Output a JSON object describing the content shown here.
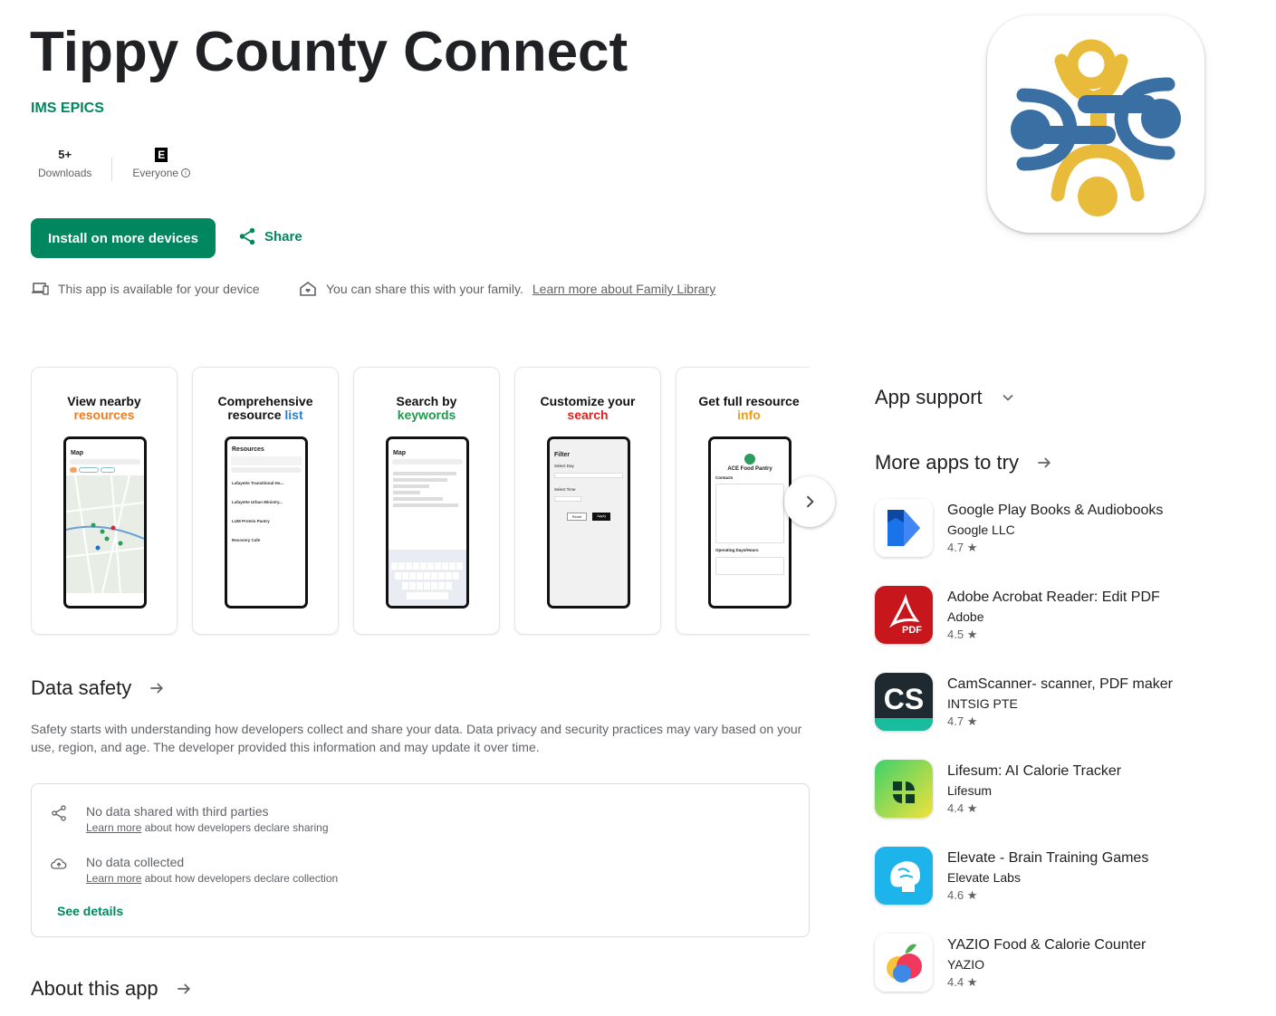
{
  "app": {
    "title": "Tippy County Connect",
    "developer": "IMS EPICS"
  },
  "stats": {
    "downloads_value": "5+",
    "downloads_label": "Downloads",
    "rating_icon": "E",
    "rating_label": "Everyone"
  },
  "actions": {
    "install_label": "Install on more devices",
    "share_label": "Share"
  },
  "availability": {
    "device_text": "This app is available for your device",
    "family_text": "You can share this with your family.",
    "family_link": "Learn more about Family Library"
  },
  "screenshots": [
    {
      "line1": "View nearby",
      "line2": "resources",
      "color": "#f07c1f"
    },
    {
      "line1": "Comprehensive",
      "line2a": "resource ",
      "line2b": "list",
      "color": "#2b7fd6"
    },
    {
      "line1": "Search by",
      "line2": "keywords",
      "color": "#1d9a4d"
    },
    {
      "line1": "Customize your",
      "line2": "search",
      "color": "#e0231e"
    },
    {
      "line1": "Get full resource",
      "line2": "info",
      "color": "#f29a1c"
    }
  ],
  "screens": {
    "s1_title": "Map",
    "s2_title": "Resources",
    "s2_items": [
      "Lafayette Transitional Ho...",
      "Lafayette Urban Ministry...",
      "LUM Protein Pantry",
      "Recovery Cafe"
    ],
    "s3_title": "Map",
    "s4_title": "Filter",
    "s4_day": "Select Day",
    "s4_time": "Select Time",
    "s4_reset": "Reset",
    "s4_apply": "Apply",
    "s5_title": "ACE Food Pantry",
    "s5_contacts": "Contacts",
    "s5_hours": "Operating Days/Hours"
  },
  "data_safety": {
    "title": "Data safety",
    "description": "Safety starts with understanding how developers collect and share your data. Data privacy and security practices may vary based on your use, region, and age. The developer provided this information and may update it over time.",
    "row1_title": "No data shared with third parties",
    "row1_link": "Learn more",
    "row1_rest": " about how developers declare sharing",
    "row2_title": "No data collected",
    "row2_link": "Learn more",
    "row2_rest": " about how developers declare collection",
    "see_details": "See details"
  },
  "about": {
    "title": "About this app"
  },
  "sidebar": {
    "app_support": "App support",
    "more_apps": "More apps to try",
    "apps": [
      {
        "name": "Google Play Books & Audiobooks",
        "developer": "Google LLC",
        "rating": "4.7"
      },
      {
        "name": "Adobe Acrobat Reader: Edit PDF",
        "developer": "Adobe",
        "rating": "4.5"
      },
      {
        "name": "CamScanner- scanner, PDF maker",
        "developer": "INTSIG PTE",
        "rating": "4.7"
      },
      {
        "name": "Lifesum: AI Calorie Tracker",
        "developer": "Lifesum",
        "rating": "4.4"
      },
      {
        "name": "Elevate - Brain Training Games",
        "developer": "Elevate Labs",
        "rating": "4.6"
      },
      {
        "name": "YAZIO Food & Calorie Counter",
        "developer": "YAZIO",
        "rating": "4.4"
      }
    ]
  },
  "colors": {
    "accent": "#01875f",
    "text": "#202124",
    "muted": "#5f6368"
  }
}
